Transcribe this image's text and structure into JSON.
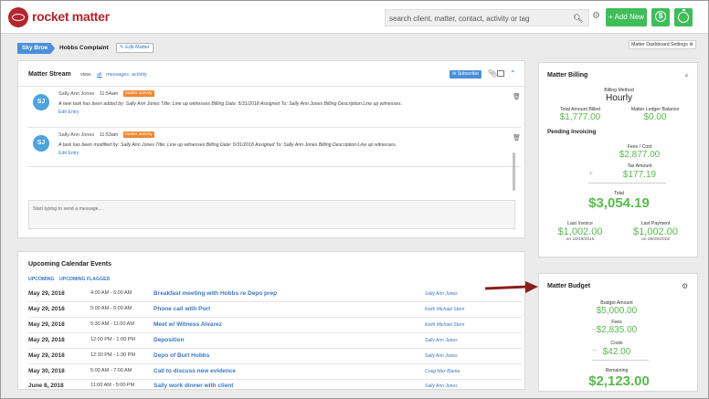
{
  "app": {
    "logo_text": "rocket matter"
  },
  "header": {
    "search_placeholder": "search client, matter, contact, activity or tag",
    "new_button": "+ Add New",
    "dollar_glyph": "$"
  },
  "breadcrumb": {
    "client": "Sky Broe",
    "matter": "Hobbs Complaint",
    "edit": "Edit Matter"
  },
  "dashboard_settings": "Matter Dashboard Settings",
  "stream": {
    "title": "Matter Stream",
    "view_label": "view:",
    "view_all": "all",
    "view_messages": "messages",
    "view_activity": "activity",
    "subscribe": "Subscribe",
    "entries": [
      {
        "initials": "SJ",
        "name": "Sally Ann Jones",
        "time": "11:54am",
        "badge": "matter activity",
        "text": "A new task has been added by: Sally Ann Jones Title: Line up witnesses Billing Date: 5/31/2018 Assigned To: Sally Ann Jones Billing Description:Line up witnesses.",
        "edit": "Edit Entry"
      },
      {
        "initials": "SJ",
        "name": "Sally Ann Jones",
        "time": "11:53am",
        "badge": "matter activity",
        "text": "A task has been modified by: Sally Ann Jones Title: Line up witnesses Billing Date: 5/31/2018 Assigned To: Sally Ann Jones Billing Description:Line up witnesses.",
        "edit": "Edit Entry"
      }
    ],
    "message_placeholder": "Start typing to send a message..."
  },
  "events": {
    "title": "Upcoming Calendar Events",
    "tab_upcoming": "UPCOMING",
    "tab_flagged": "UPCOMING FLAGGED",
    "rows": [
      {
        "date": "May 29, 2018",
        "time": "4:00 AM - 6:00 AM",
        "name": "Breakfast meeting with Hobbs re Depo prep",
        "person": "Sally Ann Jones"
      },
      {
        "date": "May 29, 2018",
        "time": "5:00 AM - 6:00 AM",
        "name": "Phone call with Port",
        "person": "Keith Michael Stern"
      },
      {
        "date": "May 29, 2018",
        "time": "5:30 AM - 11:00 AM",
        "name": "Meet w/ Witness Alvarez",
        "person": "Keith Michael Stern"
      },
      {
        "date": "May 29, 2018",
        "time": "12:00 PM - 1:00 PM",
        "name": "Deposition",
        "person": "Sally Ann Jones"
      },
      {
        "date": "May 29, 2018",
        "time": "12:30 PM - 1:30 PM",
        "name": "Depo of Burt Hobbs",
        "person": "Sally Ann Jones"
      },
      {
        "date": "May 30, 2018",
        "time": "5:00 AM - 7:00 AM",
        "name": "Call to discuss new evidence",
        "person": "Craig Max Blarke"
      },
      {
        "date": "June 8, 2018",
        "time": "11:00 AM - 5:00 PM",
        "name": "Sally work dinner with client",
        "person": "Sally Ann Jones"
      }
    ]
  },
  "billing": {
    "title": "Matter Billing",
    "method_label": "Billing Method",
    "method_value": "Hourly",
    "total_billed_label": "Total Amount Billed",
    "total_billed": "$1,777.00",
    "ledger_label": "Matter Ledger Balance",
    "ledger": "$0.00",
    "pending_title": "Pending Invoicing",
    "fees_cost_label": "Fees / Cost",
    "fees_cost": "$2,877.00",
    "tax_label": "Tax Amount",
    "tax": "$177.19",
    "plus": "+",
    "total_label": "Total",
    "total": "$3,054.19",
    "last_invoice_label": "Last Invoice",
    "last_invoice": "$1,002.00",
    "last_invoice_date": "on 10/19/2015",
    "last_payment_label": "Last Payment",
    "last_payment": "$1,002.00",
    "last_payment_date": "on 05/29/2018"
  },
  "budget": {
    "title": "Matter Budget",
    "amount_label": "Budget Amount",
    "amount": "$5,000.00",
    "fees_label": "Fees",
    "fees": "$2,835.00",
    "costs_label": "Costs",
    "costs": "$42.00",
    "minus": "–",
    "remaining_label": "Remaining",
    "remaining": "$2,123.00"
  },
  "colors": {
    "brand_red": "#b3262d",
    "green": "#3fbd58",
    "money_green": "#59b94e",
    "link_blue": "#3a78c3",
    "badge_orange": "#f08732",
    "arrow_red": "#8b1e1e"
  }
}
